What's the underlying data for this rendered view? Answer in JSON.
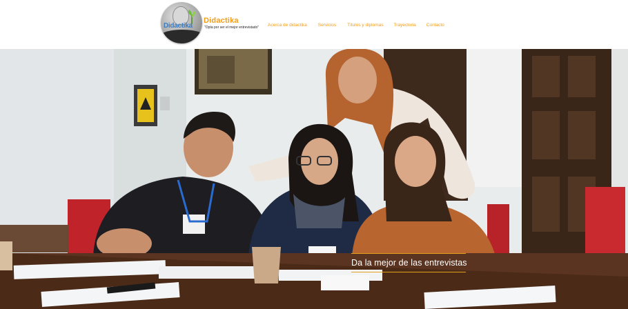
{
  "header": {
    "logo": {
      "badge_text": "Didactika",
      "name": "Didactika",
      "tagline": "\"Opta por ser el mejor entrevistado\""
    },
    "nav": [
      {
        "label": "Acerca de didactika"
      },
      {
        "label": "Servicios"
      },
      {
        "label": "Títulos y diplomas"
      },
      {
        "label": "Trayectoria"
      },
      {
        "label": "Contacto"
      }
    ]
  },
  "hero": {
    "caption": "Da la mejor de las entrevistas"
  },
  "colors": {
    "accent": "#f39c12",
    "caption_rule": "#e3a21a"
  }
}
